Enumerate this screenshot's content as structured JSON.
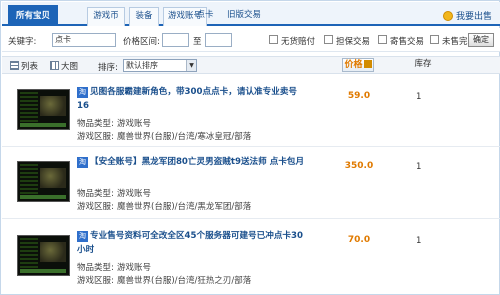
{
  "tabs": {
    "all": "所有宝贝",
    "game_coin": "游戏币",
    "equipment": "装备",
    "account": "游戏账号",
    "card": "点卡",
    "old": "旧版交易"
  },
  "want_sell": "我要出售",
  "filters": {
    "keyword_label": "关键字:",
    "keyword_value": "点卡",
    "price_label": "价格区间:",
    "price_to": "至",
    "opt_no_goods": "无货赔付",
    "opt_guarantee": "担保交易",
    "opt_consign": "寄售交易",
    "opt_unsold": "未售完",
    "ok_button": "确定"
  },
  "sortbar": {
    "list_view": "列表",
    "grid_view": "大图",
    "sort_label": "排序:",
    "sort_value": "默认排序",
    "col_price": "价格",
    "col_stock": "库存"
  },
  "items": [
    {
      "badge": "淘",
      "title": "见图各服霸建新角色，带300点点卡，请认准专业卖号16",
      "type_label": "物品类型:",
      "type_value": "游戏账号",
      "region_label": "游戏区服:",
      "region_value": "魔兽世界(台服)/台湾/寒冰皇冠/部落",
      "price": "59.0",
      "stock": "1"
    },
    {
      "badge": "淘",
      "title": "【安全账号】黑龙军团80亡灵男盗贼t9送法师 点卡包月",
      "type_label": "物品类型:",
      "type_value": "游戏账号",
      "region_label": "游戏区服:",
      "region_value": "魔兽世界(台服)/台湾/黑龙军团/部落",
      "price": "350.0",
      "stock": "1"
    },
    {
      "badge": "淘",
      "title": "专业售号资料可全改全区45个服务器可建号已冲点卡30小时",
      "type_label": "物品类型:",
      "type_value": "游戏账号",
      "region_label": "游戏区服:",
      "region_value": "魔兽世界(台服)/台湾/狂热之刃/部落",
      "price": "70.0",
      "stock": "1"
    }
  ]
}
